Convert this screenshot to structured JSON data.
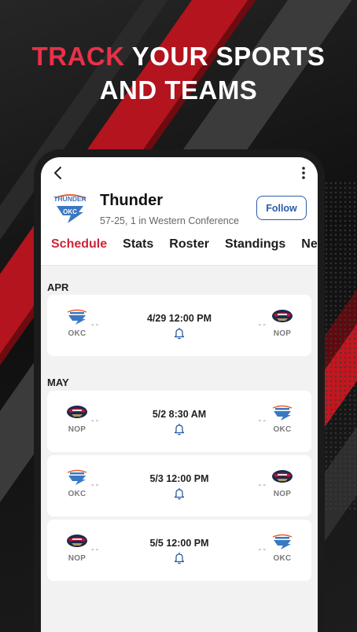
{
  "headline": {
    "accent": "TRACK",
    "line1_rest": " YOUR SPORTS",
    "line2": "AND TEAMS"
  },
  "team": {
    "name": "Thunder",
    "record": "57-25, 1 in Western Conference",
    "follow_label": "Follow",
    "logo_text": "THUNDER",
    "logo_abbr": "OKC"
  },
  "tabs": [
    {
      "label": "Schedule",
      "active": true
    },
    {
      "label": "Stats"
    },
    {
      "label": "Roster"
    },
    {
      "label": "Standings"
    },
    {
      "label": "News"
    }
  ],
  "months": [
    {
      "label": "APR",
      "games": [
        {
          "left": "OKC",
          "right": "NOP",
          "datetime": "4/29 12:00 PM",
          "left_score": "--",
          "right_score": "--"
        }
      ]
    },
    {
      "label": "MAY",
      "games": [
        {
          "left": "NOP",
          "right": "OKC",
          "datetime": "5/2 8:30 AM",
          "left_score": "--",
          "right_score": "--"
        },
        {
          "left": "OKC",
          "right": "NOP",
          "datetime": "5/3 12:00 PM",
          "left_score": "--",
          "right_score": "--"
        },
        {
          "left": "NOP",
          "right": "OKC",
          "datetime": "5/5 12:00 PM",
          "left_score": "--",
          "right_score": "--"
        }
      ]
    }
  ],
  "icons": {
    "back": "chevron-left-icon",
    "more": "more-vertical-icon",
    "bell": "bell-icon"
  },
  "colors": {
    "accent_red": "#e8314a",
    "tab_active": "#cf2534",
    "follow_blue": "#2a5ca8",
    "okc_blue": "#3a78c2",
    "okc_orange": "#ef5a2a",
    "nop_navy": "#1b2a4e",
    "nop_red": "#c8102e"
  }
}
